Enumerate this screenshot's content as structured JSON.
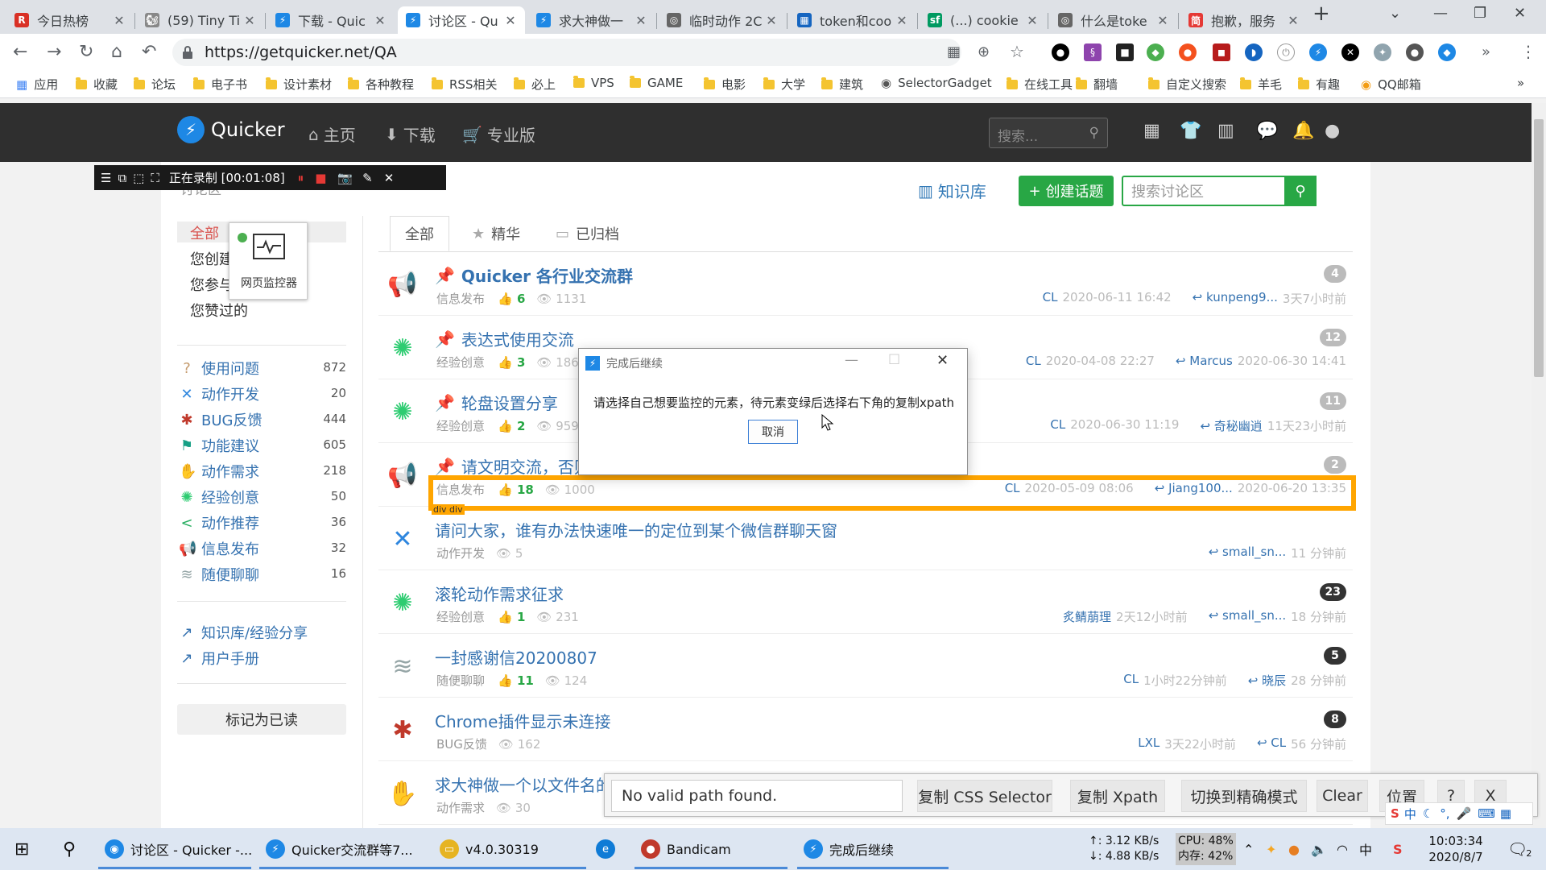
{
  "browser": {
    "tabs": [
      {
        "label": "今日热榜",
        "icon": "R",
        "color": "#d93025"
      },
      {
        "label": "(59) Tiny Ti",
        "icon": "🐿",
        "color": "#888"
      },
      {
        "label": "下载 - Quic",
        "icon": "⚡",
        "color": "#1e88e5"
      },
      {
        "label": "讨论区 - Qu",
        "icon": "⚡",
        "color": "#1e88e5"
      },
      {
        "label": "求大神做一",
        "icon": "⚡",
        "color": "#1e88e5"
      },
      {
        "label": "临时动作 2C",
        "icon": "◎",
        "color": "#666"
      },
      {
        "label": "token和coo",
        "icon": "▦",
        "color": "#1565c0"
      },
      {
        "label": "(...) cookie",
        "icon": "sf",
        "color": "#009a61"
      },
      {
        "label": "什么是toke",
        "icon": "◎",
        "color": "#666"
      },
      {
        "label": "抱歉，服务",
        "icon": "简",
        "color": "#e53935"
      }
    ],
    "url": "https://getquicker.net/QA",
    "bookmarks": [
      "应用",
      "收藏",
      "论坛",
      "电子书",
      "设计素材",
      "各种教程",
      "RSS相关",
      "必上",
      "VPS",
      "GAME",
      "电影",
      "大学",
      "建筑",
      "SelectorGadget",
      "在线工具",
      "翻墙",
      "自定义搜索",
      "羊毛",
      "有趣",
      "QQ邮箱"
    ]
  },
  "site": {
    "logo": "Quicker",
    "nav": [
      {
        "label": "主页",
        "icon": "⌂"
      },
      {
        "label": "下载",
        "icon": "⬇"
      },
      {
        "label": "专业版",
        "icon": "🛒"
      }
    ],
    "search_placeholder": "搜索...",
    "kb_label": "知识库",
    "new_topic": "创建话题",
    "discuss_search_placeholder": "搜索讨论区"
  },
  "recorder": {
    "status": "正在录制 [00:01:08]"
  },
  "sidebar": {
    "breadcrumb": "讨论区",
    "filters": [
      "全部",
      "您创建",
      "您参与",
      "您赞过的"
    ],
    "categories": [
      {
        "label": "使用问题",
        "count": "872",
        "icon": "?",
        "color": "#c49a6c"
      },
      {
        "label": "动作开发",
        "count": "20",
        "icon": "✕",
        "color": "#2e86de"
      },
      {
        "label": "BUG反馈",
        "count": "444",
        "icon": "✱",
        "color": "#c0392b"
      },
      {
        "label": "功能建议",
        "count": "605",
        "icon": "⚑",
        "color": "#16a085"
      },
      {
        "label": "动作需求",
        "count": "218",
        "icon": "✋",
        "color": "#b5895a"
      },
      {
        "label": "经验创意",
        "count": "50",
        "icon": "✺",
        "color": "#2ecc71"
      },
      {
        "label": "动作推荐",
        "count": "36",
        "icon": "<",
        "color": "#27ae60"
      },
      {
        "label": "信息发布",
        "count": "32",
        "icon": "📢",
        "color": "#444"
      },
      {
        "label": "随便聊聊",
        "count": "16",
        "icon": "≋",
        "color": "#95a5a6"
      }
    ],
    "links": [
      "知识库/经验分享",
      "用户手册"
    ],
    "mark_read": "标记为已读"
  },
  "content_tabs": [
    "全部",
    "精华",
    "已归档"
  ],
  "topics": [
    {
      "title": "Quicker 各行业交流群",
      "pinned": true,
      "bold": true,
      "cat": "信息发布",
      "likes": "6",
      "views": "1131",
      "author": "CL",
      "created": "2020-06-11 16:42",
      "replier": "kunpeng9...",
      "replied": "3天7小时前",
      "replies": "4",
      "badge_color": "#bbb",
      "icon": "📢"
    },
    {
      "title": "表达式使用交流",
      "pinned": true,
      "bold": false,
      "cat": "经验创意",
      "likes": "3",
      "views": "186",
      "author": "CL",
      "created": "2020-04-08 22:27",
      "replier": "Marcus",
      "replied": "2020-06-30 14:41",
      "replies": "12",
      "badge_color": "#bbb",
      "icon": "✺"
    },
    {
      "title": "轮盘设置分享",
      "pinned": true,
      "bold": false,
      "cat": "经验创意",
      "likes": "2",
      "views": "959",
      "author": "CL",
      "created": "2020-06-30 11:19",
      "replier": "奇秘幽逍",
      "replied": "11天23小时前",
      "replies": "11",
      "badge_color": "#bbb",
      "icon": "✺"
    },
    {
      "title": "请文明交流，否则",
      "pinned": true,
      "bold": false,
      "cat": "信息发布",
      "likes": "18",
      "views": "1000",
      "author": "CL",
      "created": "2020-05-09 08:06",
      "replier": "Jiang100...",
      "replied": "2020-06-20 13:35",
      "replies": "2",
      "badge_color": "#bbb",
      "icon": "📢"
    },
    {
      "title": "请问大家，谁有办法快速唯一的定位到某个微信群聊天窗",
      "pinned": false,
      "bold": false,
      "cat": "动作开发",
      "likes": "",
      "views": "5",
      "author": "",
      "created": "",
      "replier": "small_sn...",
      "replied": "11 分钟前",
      "replies": "",
      "badge_color": "#bbb",
      "icon": "✕"
    },
    {
      "title": "滚轮动作需求征求",
      "pinned": false,
      "bold": false,
      "cat": "经验创意",
      "likes": "1",
      "views": "231",
      "author": "炙鲭萠理",
      "created": "2天12小时前",
      "replier": "small_sn...",
      "replied": "18 分钟前",
      "replies": "23",
      "badge_color": "#333",
      "icon": "✺"
    },
    {
      "title": "一封感谢信20200807",
      "pinned": false,
      "bold": false,
      "cat": "随便聊聊",
      "likes": "11",
      "views": "124",
      "author": "CL",
      "created": "1小时22分钟前",
      "replier": "晓辰",
      "replied": "28 分钟前",
      "replies": "5",
      "badge_color": "#333",
      "icon": "≋"
    },
    {
      "title": "Chrome插件显示未连接",
      "pinned": false,
      "bold": false,
      "cat": "BUG反馈",
      "likes": "",
      "views": "162",
      "author": "LXL",
      "created": "3天22小时前",
      "replier": "CL",
      "replied": "56 分钟前",
      "replies": "8",
      "badge_color": "#333",
      "icon": "✱"
    },
    {
      "title": "求大神做一个以文件名的",
      "pinned": false,
      "bold": false,
      "cat": "动作需求",
      "likes": "",
      "views": "30",
      "author": "",
      "created": "",
      "replier": "",
      "replied": "",
      "replies": "",
      "badge_color": "#333",
      "icon": "✋"
    }
  ],
  "monitor": {
    "label": "网页监控器"
  },
  "dialog": {
    "title": "完成后继续",
    "message": "请选择自己想要监控的元素，待元素变绿后选择右下角的复制xpath",
    "cancel": "取消"
  },
  "highlight": {
    "label": "div div"
  },
  "xpath_bar": {
    "status": "No valid path found.",
    "css": "复制 CSS Selector",
    "xpath": "复制 Xpath",
    "mode": "切换到精确模式",
    "clear": "Clear",
    "position": "位置",
    "help": "?",
    "close": "X"
  },
  "taskbar": {
    "items": [
      {
        "label": "讨论区 - Quicker -...",
        "color": "#1e88e5",
        "icon": "◉"
      },
      {
        "label": "Quicker交流群等7...",
        "color": "#1e88e5",
        "icon": "⚡"
      },
      {
        "label": "v4.0.30319",
        "color": "#e6b422",
        "icon": "▭"
      },
      {
        "label": "",
        "color": "#0f7bd6",
        "icon": "e"
      },
      {
        "label": "Bandicam",
        "color": "#c0392b",
        "icon": "●"
      },
      {
        "label": "完成后继续",
        "color": "#1e88e5",
        "icon": "⚡"
      }
    ],
    "net_up": "↑: 3.12 KB/s",
    "net_down": "↓: 4.88 KB/s",
    "cpu": "CPU: 48%",
    "mem": "内存: 42%",
    "time": "10:03:34",
    "date": "2020/8/7",
    "ime": "中",
    "notify": "2"
  }
}
